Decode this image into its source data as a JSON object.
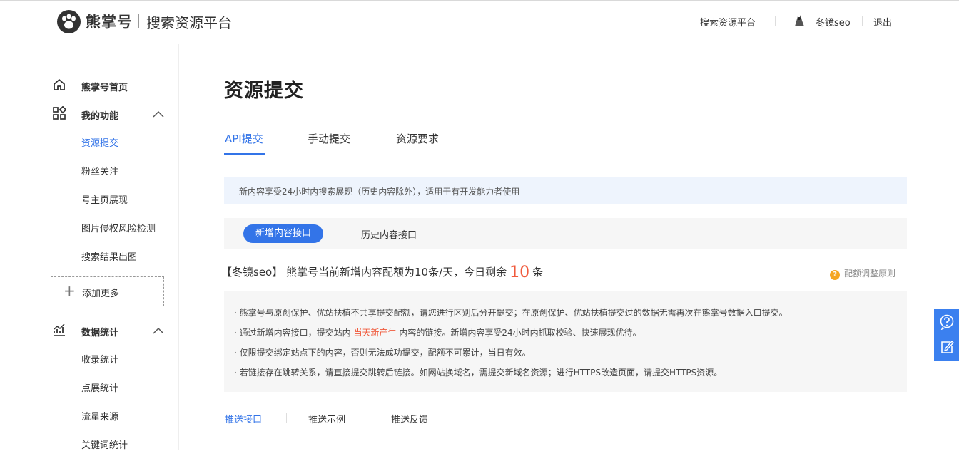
{
  "header": {
    "brand": "熊掌号",
    "subtitle": "搜索资源平台",
    "nav_platform": "搜索资源平台",
    "username": "冬镜seo",
    "logout": "退出"
  },
  "sidebar": {
    "home": "熊掌号首页",
    "my_features": "我的功能",
    "feature_items": [
      "资源提交",
      "粉丝关注",
      "号主页展现",
      "图片侵权风险检测",
      "搜索结果出图"
    ],
    "add_more": "添加更多",
    "data_stats": "数据统计",
    "stats_items": [
      "收录统计",
      "点展统计",
      "流量来源",
      "关键词统计"
    ]
  },
  "main": {
    "title": "资源提交",
    "tabs": [
      "API提交",
      "手动提交",
      "资源要求"
    ],
    "notice": "新内容享受24小时内搜索展现（历史内容除外），适用于有开发能力者使用",
    "subtabs": [
      "新增内容接口",
      "历史内容接口"
    ],
    "quota_prefix": "【冬镜seo】 熊掌号当前新增内容配额为10条/天，今日剩余",
    "quota_num": "10",
    "quota_suffix": "条",
    "rule_link": "配额调整原则",
    "tips": {
      "t1": "· 熊掌号与原创保护、优站扶植不共享提交配额，请您进行区别后分开提交；在原创保护、优站扶植提交过的数据无需再次在熊掌号数据入口提交。",
      "t2a": "· 通过新增内容接口，提交站内",
      "t2h": "当天新产生",
      "t2b": "内容的链接。新增内容享受24小时内抓取校验、快速展现优待。",
      "t3": "· 仅限提交绑定站点下的内容，否则无法成功提交，配额不可累计，当日有效。",
      "t4": "· 若链接存在跳转关系，请直接提交跳转后链接。如网站换域名，需提交新域名资源；进行HTTPS改造页面，请提交HTTPS资源。"
    },
    "bottom_tabs": [
      "推送接口",
      "推送示例",
      "推送反馈"
    ]
  },
  "colors": {
    "accent": "#3374e8",
    "highlight": "#f05a3c",
    "warning": "#f5a623"
  }
}
